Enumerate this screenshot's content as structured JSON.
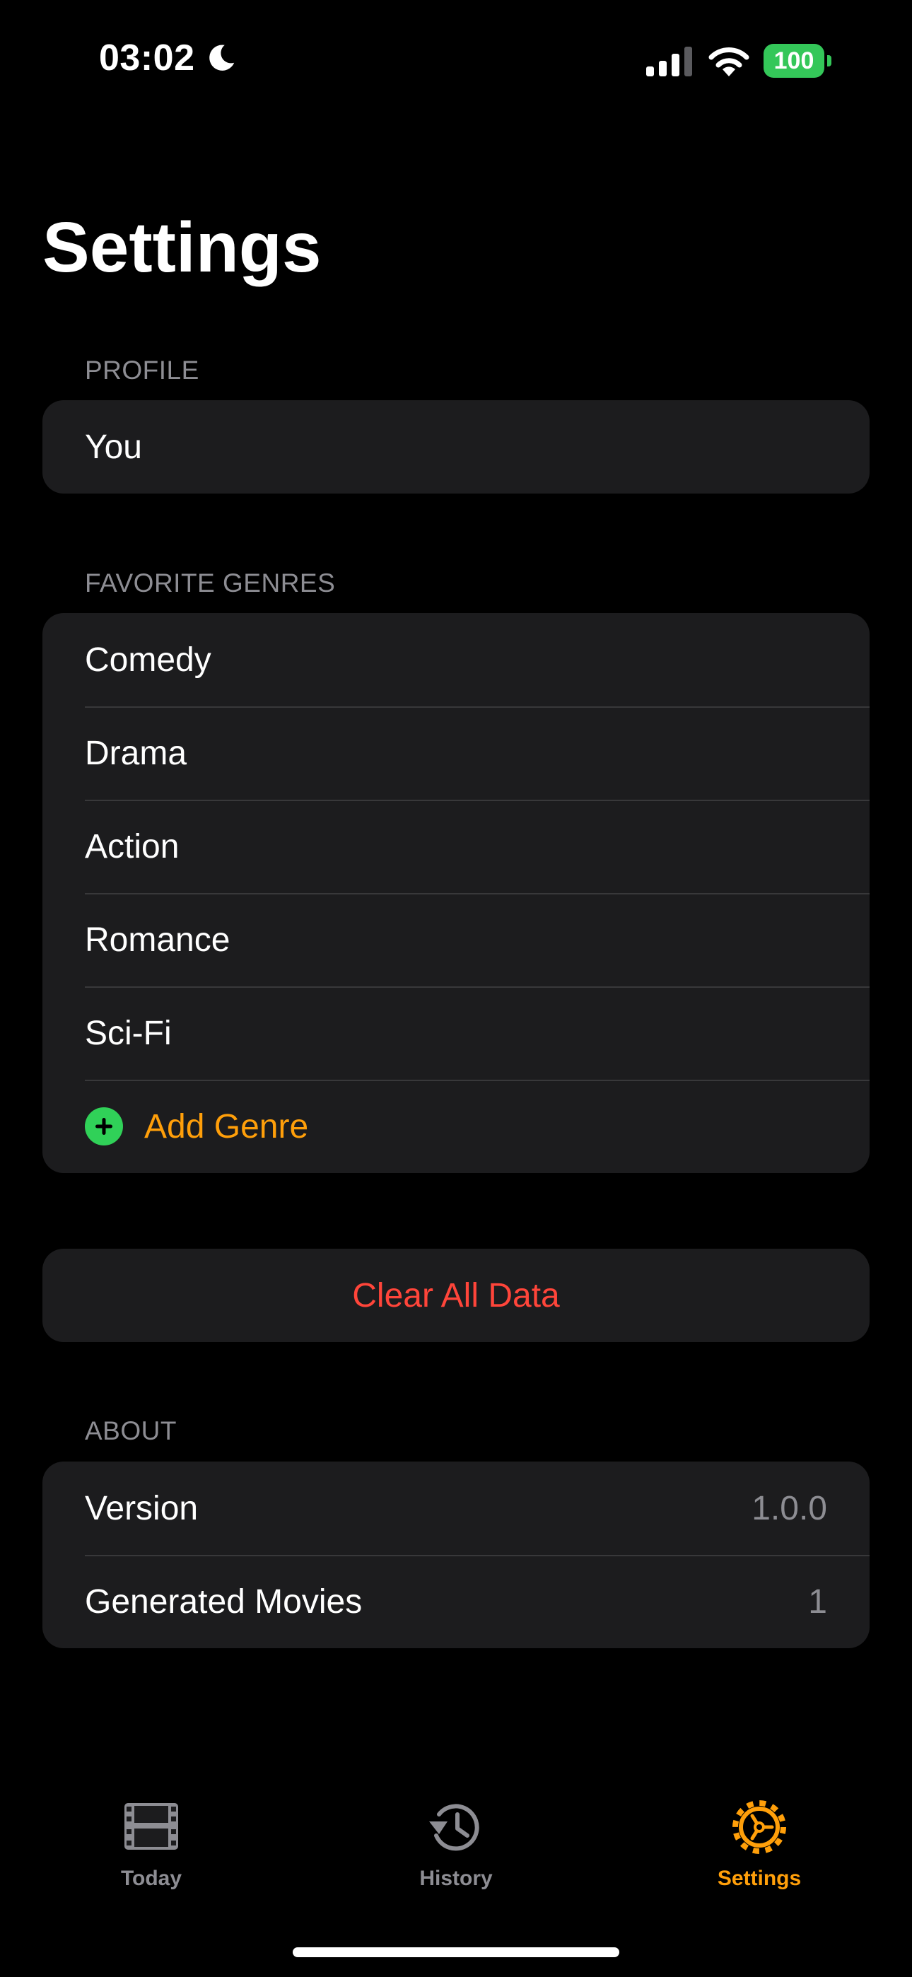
{
  "status_bar": {
    "time": "03:02",
    "battery": "100"
  },
  "page": {
    "title": "Settings"
  },
  "profile": {
    "header": "PROFILE",
    "name": "You"
  },
  "genres": {
    "header": "FAVORITE GENRES",
    "items": [
      "Comedy",
      "Drama",
      "Action",
      "Romance",
      "Sci-Fi"
    ],
    "add_label": "Add Genre"
  },
  "actions": {
    "clear_label": "Clear All Data"
  },
  "about": {
    "header": "ABOUT",
    "version_label": "Version",
    "version_value": "1.0.0",
    "movies_label": "Generated Movies",
    "movies_value": "1"
  },
  "tabs": [
    {
      "label": "Today",
      "icon": "film-icon",
      "active": false
    },
    {
      "label": "History",
      "icon": "history-icon",
      "active": false
    },
    {
      "label": "Settings",
      "icon": "gear-icon",
      "active": true
    }
  ],
  "colors": {
    "accent": "#ff9f0a",
    "danger": "#ff453a",
    "add_icon": "#30d158",
    "battery": "#34c759",
    "cell_background": "#1c1c1e",
    "secondary_text": "#8d8d93"
  }
}
